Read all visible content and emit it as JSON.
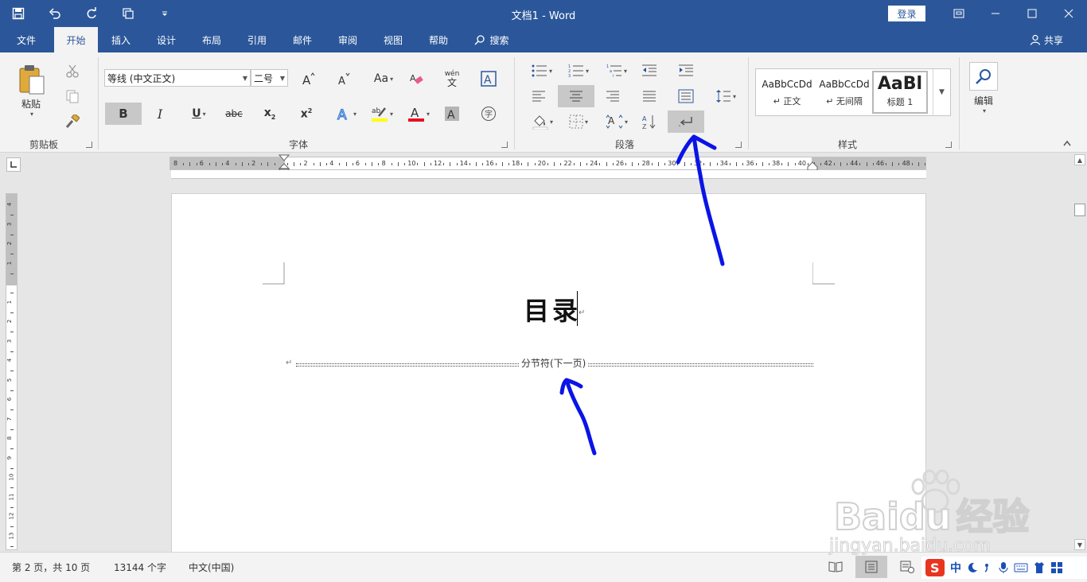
{
  "window": {
    "title": "文档1  -  Word",
    "login_label": "登录"
  },
  "tabs": [
    {
      "label": "文件"
    },
    {
      "label": "开始"
    },
    {
      "label": "插入"
    },
    {
      "label": "设计"
    },
    {
      "label": "布局"
    },
    {
      "label": "引用"
    },
    {
      "label": "邮件"
    },
    {
      "label": "审阅"
    },
    {
      "label": "视图"
    },
    {
      "label": "帮助"
    },
    {
      "label": "搜索"
    }
  ],
  "share_label": "共享",
  "ribbon": {
    "clipboard": {
      "paste_label": "粘贴",
      "group_label": "剪贴板"
    },
    "font": {
      "font_name": "等线 (中文正文)",
      "font_size": "二号",
      "group_label": "字体",
      "case_label": "Aa",
      "phonetic_label": "wén"
    },
    "paragraph": {
      "group_label": "段落"
    },
    "styles": {
      "group_label": "样式",
      "items": [
        {
          "sample": "AaBbCcDd",
          "name": "↵ 正文"
        },
        {
          "sample": "AaBbCcDd",
          "name": "↵ 无间隔"
        },
        {
          "sample": "AaBl",
          "name": "标题 1"
        }
      ]
    },
    "editing": {
      "label": "编辑"
    }
  },
  "ruler": {
    "h_labels": [
      "8",
      "6",
      "4",
      "2",
      "",
      "2",
      "4",
      "6",
      "8",
      "10",
      "12",
      "14",
      "16",
      "18",
      "20",
      "22",
      "24",
      "26",
      "28",
      "30",
      "32",
      "34",
      "36",
      "38",
      "40",
      "42",
      "44",
      "46",
      "48"
    ],
    "v_labels": [
      "4",
      "3",
      "2",
      "1",
      "",
      "1",
      "2",
      "3",
      "4",
      "5",
      "6",
      "7",
      "8",
      "9",
      "10",
      "11",
      "12",
      "13"
    ]
  },
  "document": {
    "heading": "目录",
    "para_mark": "↵",
    "section_break": "分节符(下一页)"
  },
  "status": {
    "page_info": "第 2 页，共 10 页",
    "word_count": "13144 个字",
    "language": "中文(中国)"
  },
  "ime": {
    "mode": "中"
  },
  "watermark": {
    "brand": "Baidu",
    "brand_cn": "经验",
    "url": "jingyan.baidu.com"
  },
  "colors": {
    "word_blue": "#2b579a",
    "highlight_yellow": "#ffff00",
    "font_red": "#e81123",
    "annotation_blue": "#0a14e6"
  }
}
